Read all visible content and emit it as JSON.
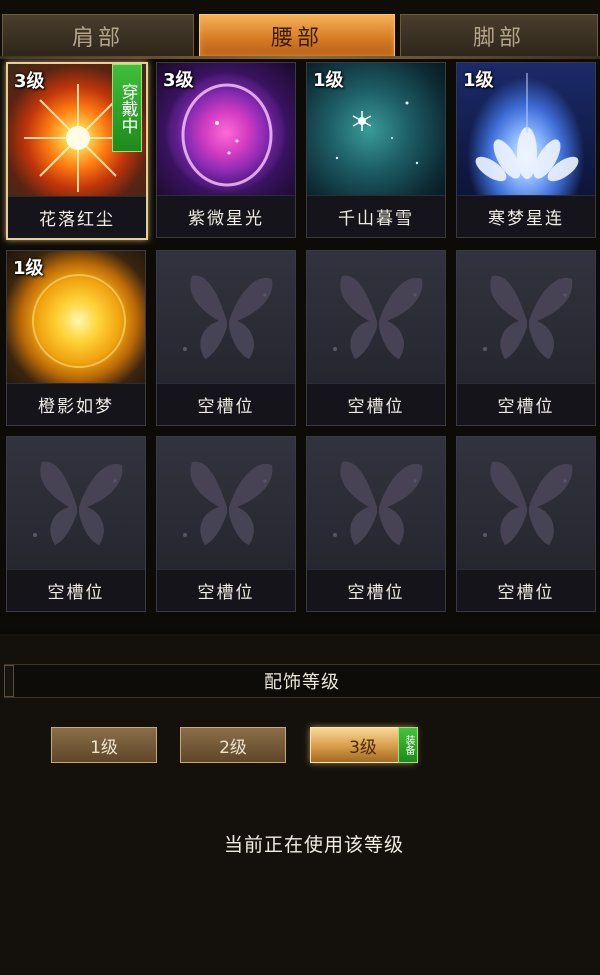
{
  "tabs": [
    {
      "label": "肩部",
      "active": false
    },
    {
      "label": "腰部",
      "active": true
    },
    {
      "label": "脚部",
      "active": false
    }
  ],
  "accessories": [
    {
      "name": "花落红尘",
      "level": "3级",
      "wearing": true,
      "badge": "穿戴中",
      "art": "sun-red"
    },
    {
      "name": "紫微星光",
      "level": "3级",
      "wearing": false,
      "art": "purple-orb"
    },
    {
      "name": "千山暮雪",
      "level": "1级",
      "wearing": false,
      "art": "teal-snow"
    },
    {
      "name": "寒梦星连",
      "level": "1级",
      "wearing": false,
      "art": "lotus"
    },
    {
      "name": "橙影如梦",
      "level": "1级",
      "wearing": false,
      "art": "orange-sun"
    },
    {
      "name": "空槽位",
      "empty": true
    },
    {
      "name": "空槽位",
      "empty": true
    },
    {
      "name": "空槽位",
      "empty": true
    },
    {
      "name": "空槽位",
      "empty": true
    },
    {
      "name": "空槽位",
      "empty": true
    },
    {
      "name": "空槽位",
      "empty": true
    },
    {
      "name": "空槽位",
      "empty": true
    }
  ],
  "level_panel": {
    "title": "配饰等级",
    "levels": [
      "1级",
      "2级",
      "3级"
    ],
    "selected_level": "3级",
    "equip_badge": "装备",
    "status_text": "当前正在使用该等级"
  },
  "colors": {
    "tab_active": "#d57a22",
    "wearing_badge": "#3fbf3a",
    "level_button": "#8a6e4a",
    "level_button_active": "#d69c4a"
  }
}
